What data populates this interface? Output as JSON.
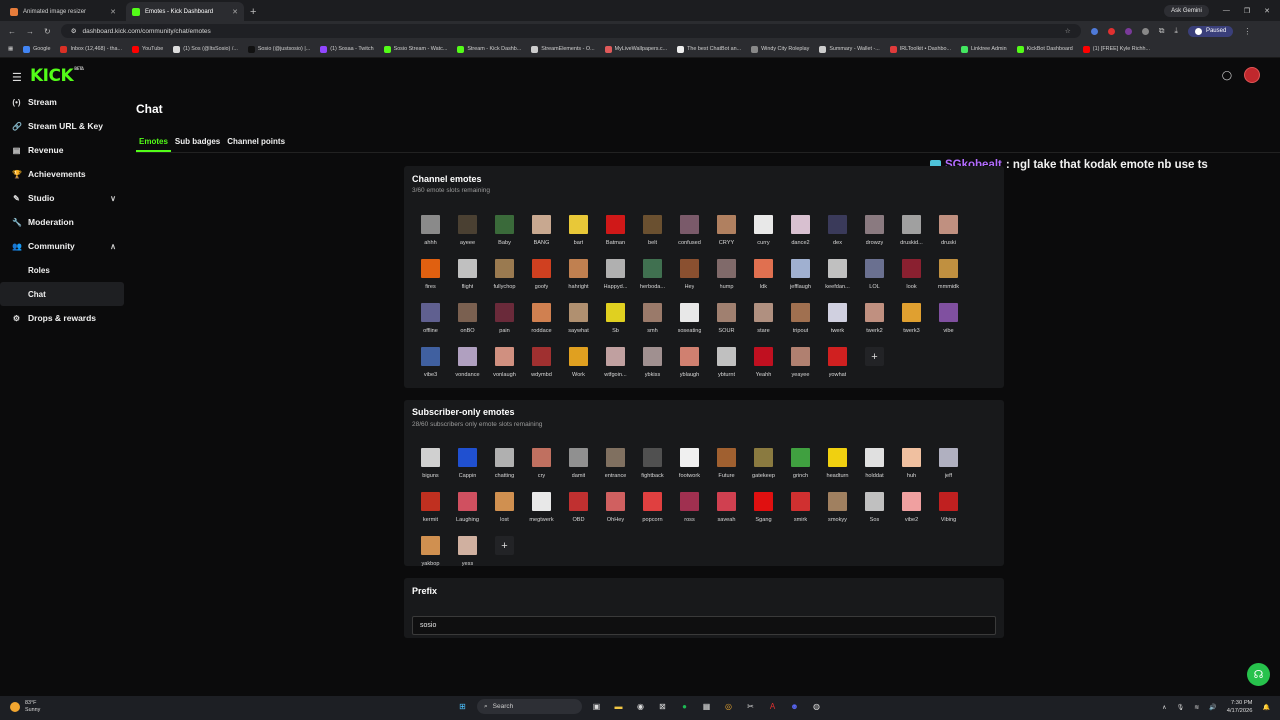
{
  "browser": {
    "tabs": [
      {
        "title": "Animated image resizer",
        "color": "#e67c3b",
        "active": false
      },
      {
        "title": "Emotes - Kick Dashboard",
        "color": "#53fc18",
        "active": true
      }
    ],
    "ask_gemini": "Ask Gemini",
    "url": "dashboard.kick.com/community/chat/emotes",
    "profile_status": "Paused",
    "bookmarks": [
      {
        "label": "Google",
        "color": "#4285f4"
      },
      {
        "label": "Inbox (12,468) - tha...",
        "color": "#d93025"
      },
      {
        "label": "YouTube",
        "color": "#ff0000"
      },
      {
        "label": "(1) Sos (@ItsSosio) /...",
        "color": "#dddddd"
      },
      {
        "label": "Sosio (@justsosio) |...",
        "color": "#111111"
      },
      {
        "label": "(1) Sosaa - Twitch",
        "color": "#9146ff"
      },
      {
        "label": "Sosio Stream - Watc...",
        "color": "#53fc18"
      },
      {
        "label": "Stream - Kick Dashb...",
        "color": "#53fc18"
      },
      {
        "label": "StreamElements - O...",
        "color": "#cccccc"
      },
      {
        "label": "MyLiveWallpapers.c...",
        "color": "#e05a5a"
      },
      {
        "label": "The best ChatBot an...",
        "color": "#eeeeee"
      },
      {
        "label": "Windy City Roleplay",
        "color": "#888888"
      },
      {
        "label": "Summary - Wallet -...",
        "color": "#cccccc"
      },
      {
        "label": "IRLToolkit • Dashbo...",
        "color": "#e03b3b"
      },
      {
        "label": "Linktree Admin",
        "color": "#43e660"
      },
      {
        "label": "KickBot Dashboard",
        "color": "#53fc18"
      },
      {
        "label": "(1) [FREE] Kyle Richh...",
        "color": "#ff0000"
      }
    ]
  },
  "app": {
    "logo": "KICK",
    "logo_tag": "BETA"
  },
  "sidebar": {
    "items": [
      {
        "label": "Stream",
        "icon": "(•)"
      },
      {
        "label": "Stream URL & Key",
        "icon": "🔗"
      },
      {
        "label": "Revenue",
        "icon": "▤"
      },
      {
        "label": "Achievements",
        "icon": "🏆"
      },
      {
        "label": "Studio",
        "icon": "✎",
        "chevron": "∨"
      },
      {
        "label": "Moderation",
        "icon": "🔧"
      },
      {
        "label": "Community",
        "icon": "👥",
        "chevron": "∧"
      }
    ],
    "community_sub": [
      {
        "label": "Roles",
        "active": false
      },
      {
        "label": "Chat",
        "active": true
      }
    ],
    "drops": {
      "label": "Drops & rewards",
      "icon": "⚙"
    }
  },
  "main": {
    "title": "Chat",
    "tabs": [
      {
        "label": "Emotes",
        "active": true
      },
      {
        "label": "Sub badges",
        "active": false
      },
      {
        "label": "Channel points",
        "active": false
      }
    ]
  },
  "overlay_chat": {
    "user": "SGkobealt",
    "message": ": ngl take that kodak emote nb use ts"
  },
  "channel_emotes": {
    "title": "Channel emotes",
    "subtitle": "3/60 emote slots remaining",
    "emotes": [
      {
        "n": "ahhh",
        "c": "#8a8a8a"
      },
      {
        "n": "ayeee",
        "c": "#4a4032"
      },
      {
        "n": "Baby",
        "c": "#3a6a3a"
      },
      {
        "n": "BANG",
        "c": "#c8a890"
      },
      {
        "n": "bart",
        "c": "#e8c838"
      },
      {
        "n": "Batman",
        "c": "#d01818"
      },
      {
        "n": "belt",
        "c": "#6a5030"
      },
      {
        "n": "confused",
        "c": "#7a5a6a"
      },
      {
        "n": "CRYY",
        "c": "#b08060"
      },
      {
        "n": "curry",
        "c": "#e8e8e8"
      },
      {
        "n": "dance2",
        "c": "#d8c0d0"
      },
      {
        "n": "dex",
        "c": "#3a3a5a"
      },
      {
        "n": "drowzy",
        "c": "#8a7a80"
      },
      {
        "n": "druskid...",
        "c": "#a0a0a0"
      },
      {
        "n": "druski",
        "c": "#c09080"
      },
      {
        "n": "fires",
        "c": "#e06010"
      },
      {
        "n": "flight",
        "c": "#c0c0c0"
      },
      {
        "n": "fullychop",
        "c": "#9a7a50"
      },
      {
        "n": "goofy",
        "c": "#d04020"
      },
      {
        "n": "hahright",
        "c": "#c08050"
      },
      {
        "n": "Happyd...",
        "c": "#b0b0b0"
      },
      {
        "n": "herboda...",
        "c": "#407050"
      },
      {
        "n": "Hey",
        "c": "#8a5030"
      },
      {
        "n": "hump",
        "c": "#806a6a"
      },
      {
        "n": "ldk",
        "c": "#e07050"
      },
      {
        "n": "jefflaugh",
        "c": "#a0b0d0"
      },
      {
        "n": "keefdan...",
        "c": "#c0c0c0"
      },
      {
        "n": "LOL",
        "c": "#6a7090"
      },
      {
        "n": "look",
        "c": "#8a2030"
      },
      {
        "n": "mmmidk",
        "c": "#c09040"
      },
      {
        "n": "offline",
        "c": "#606090"
      },
      {
        "n": "onBO",
        "c": "#7a6050"
      },
      {
        "n": "pain",
        "c": "#6a2a3a"
      },
      {
        "n": "roddace",
        "c": "#d08050"
      },
      {
        "n": "saywhat",
        "c": "#b09070"
      },
      {
        "n": "Sb",
        "c": "#e0d020"
      },
      {
        "n": "smh",
        "c": "#9a7a6a"
      },
      {
        "n": "soseating",
        "c": "#e8e8e8"
      },
      {
        "n": "SOUR",
        "c": "#a08070"
      },
      {
        "n": "stare",
        "c": "#b09080"
      },
      {
        "n": "tripout",
        "c": "#a07050"
      },
      {
        "n": "twerk",
        "c": "#d0d0e0"
      },
      {
        "n": "twerk2",
        "c": "#c09080"
      },
      {
        "n": "twerk3",
        "c": "#e0a030"
      },
      {
        "n": "vibe",
        "c": "#8050a0"
      },
      {
        "n": "vibe3",
        "c": "#4060a0"
      },
      {
        "n": "vondance",
        "c": "#b0a0c0"
      },
      {
        "n": "vonlaugh",
        "c": "#d09080"
      },
      {
        "n": "wdymbd",
        "c": "#a03030"
      },
      {
        "n": "Work",
        "c": "#e0a020"
      },
      {
        "n": "wtfgoin...",
        "c": "#c0a0a0"
      },
      {
        "n": "ybkiss",
        "c": "#a09090"
      },
      {
        "n": "yblaugh",
        "c": "#d08070"
      },
      {
        "n": "ybturnt",
        "c": "#c0c0c0"
      },
      {
        "n": "Yeahh",
        "c": "#c01020"
      },
      {
        "n": "yeayee",
        "c": "#b08070"
      },
      {
        "n": "yowhat",
        "c": "#d02020"
      }
    ]
  },
  "sub_emotes": {
    "title": "Subscriber-only emotes",
    "subtitle": "28/60 subscribers only emote slots remaining",
    "emotes": [
      {
        "n": "biguns",
        "c": "#d0d0d0"
      },
      {
        "n": "Cappin",
        "c": "#2050d0"
      },
      {
        "n": "chatting",
        "c": "#b0b0b0"
      },
      {
        "n": "cry",
        "c": "#c07060"
      },
      {
        "n": "damit",
        "c": "#909090"
      },
      {
        "n": "entrance",
        "c": "#807060"
      },
      {
        "n": "fightback",
        "c": "#505050"
      },
      {
        "n": "footwork",
        "c": "#f0f0f0"
      },
      {
        "n": "Future",
        "c": "#a06030"
      },
      {
        "n": "gatekeep",
        "c": "#8a7a40"
      },
      {
        "n": "grinch",
        "c": "#40a040"
      },
      {
        "n": "headturn",
        "c": "#f0d010"
      },
      {
        "n": "holddat",
        "c": "#e0e0e0"
      },
      {
        "n": "huh",
        "c": "#f0c0a0"
      },
      {
        "n": "jeff",
        "c": "#b0b0c0"
      },
      {
        "n": "kermit",
        "c": "#c03020"
      },
      {
        "n": "Laughing",
        "c": "#d05060"
      },
      {
        "n": "lost",
        "c": "#d09050"
      },
      {
        "n": "megtwerk",
        "c": "#e8e8e8"
      },
      {
        "n": "OBD",
        "c": "#c03030"
      },
      {
        "n": "OhHey",
        "c": "#d06060"
      },
      {
        "n": "popcorn",
        "c": "#e04040"
      },
      {
        "n": "ross",
        "c": "#a03050"
      },
      {
        "n": "saveah",
        "c": "#d04050"
      },
      {
        "n": "Sgang",
        "c": "#e01010"
      },
      {
        "n": "smirk",
        "c": "#d03030"
      },
      {
        "n": "smokyy",
        "c": "#a08060"
      },
      {
        "n": "Sos",
        "c": "#c0c0c0"
      },
      {
        "n": "vibe2",
        "c": "#f0a0a0"
      },
      {
        "n": "Vibing",
        "c": "#c02020"
      },
      {
        "n": "yakbop",
        "c": "#d09050"
      },
      {
        "n": "yess",
        "c": "#d0b0a0"
      }
    ]
  },
  "prefix": {
    "title": "Prefix",
    "value": "sosio"
  },
  "taskbar": {
    "temp": "83°F",
    "condition": "Sunny",
    "search": "Search",
    "time": "7:30 PM",
    "date": "4/17/2026"
  }
}
